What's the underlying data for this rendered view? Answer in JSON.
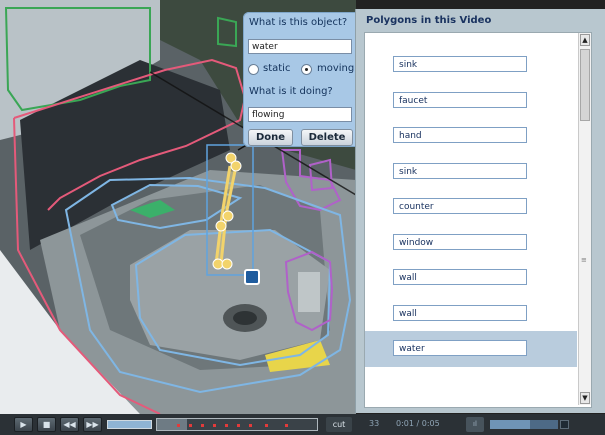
{
  "popup": {
    "object_question": "What is this object?",
    "object_value": "water",
    "motion_options": {
      "static": "static",
      "moving": "moving",
      "selected": "moving"
    },
    "action_question": "What is it doing?",
    "action_value": "flowing",
    "done_label": "Done",
    "delete_label": "Delete"
  },
  "panel": {
    "title": "Polygons in this Video",
    "items": [
      {
        "label": "sink"
      },
      {
        "label": "faucet"
      },
      {
        "label": "hand"
      },
      {
        "label": "sink"
      },
      {
        "label": "counter"
      },
      {
        "label": "window"
      },
      {
        "label": "wall"
      },
      {
        "label": "wall"
      },
      {
        "label": "water",
        "selected": true
      }
    ],
    "scroll_up_icon": "▲",
    "scroll_down_icon": "▼",
    "scroll_grip_icon": "≡"
  },
  "controls": {
    "play_icon": "▶",
    "stop_icon": "■",
    "rewind_icon": "◀◀",
    "forward_icon": "▶▶",
    "cut_label": "cut",
    "frame_number": "33",
    "time": "0:01 / 0:05",
    "mini_icon": "ıl"
  },
  "colors": {
    "polygon_sink": "#7fb6e4",
    "polygon_hand": "#e45a7a",
    "polygon_window": "#3aa655",
    "polygon_faucet": "#b061c9",
    "polygon_water": "#f2d36b",
    "panel_bg": "#b8c7cf",
    "popup_bg": "#a8c8e6",
    "selected_row": "#b9ccdd"
  }
}
